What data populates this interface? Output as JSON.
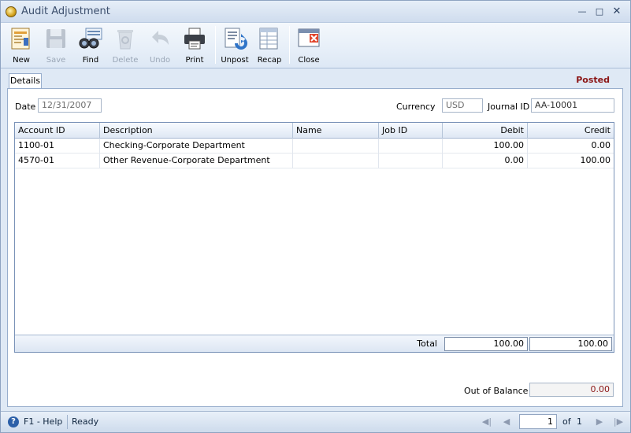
{
  "window": {
    "title": "Audit Adjustment"
  },
  "toolbar": {
    "buttons": [
      {
        "label": "New",
        "icon": "new-document-icon",
        "enabled": true
      },
      {
        "label": "Save",
        "icon": "floppy-disk-icon",
        "enabled": false
      },
      {
        "label": "Find",
        "icon": "binoculars-icon",
        "enabled": true
      },
      {
        "label": "Delete",
        "icon": "recycle-bin-icon",
        "enabled": false
      },
      {
        "label": "Undo",
        "icon": "undo-arrow-icon",
        "enabled": false
      },
      {
        "label": "Print",
        "icon": "printer-icon",
        "enabled": true
      },
      {
        "label": "Unpost",
        "icon": "unpost-icon",
        "enabled": true
      },
      {
        "label": "Recap",
        "icon": "recap-icon",
        "enabled": true
      },
      {
        "label": "Close",
        "icon": "close-window-icon",
        "enabled": true
      }
    ]
  },
  "tabs": [
    {
      "label": "Details",
      "active": true
    }
  ],
  "status": "Posted",
  "form": {
    "date_label": "Date",
    "date_value": "12/31/2007",
    "currency_label": "Currency",
    "currency_value": "USD",
    "journal_label": "Journal ID",
    "journal_value": "AA-10001"
  },
  "grid": {
    "columns": [
      "Account ID",
      "Description",
      "Name",
      "Job ID",
      "Debit",
      "Credit"
    ],
    "rows": [
      {
        "account": "1100-01",
        "description": "Checking-Corporate Department",
        "name": "",
        "job": "",
        "debit": "100.00",
        "credit": "0.00"
      },
      {
        "account": "4570-01",
        "description": "Other Revenue-Corporate Department",
        "name": "",
        "job": "",
        "debit": "0.00",
        "credit": "100.00"
      }
    ],
    "total_label": "Total",
    "total_debit": "100.00",
    "total_credit": "100.00"
  },
  "balance": {
    "label": "Out of Balance",
    "value": "0.00"
  },
  "statusbar": {
    "help": "F1 - Help",
    "state": "Ready",
    "page": "1",
    "of_label": "of",
    "total_pages": "1"
  },
  "colors": {
    "posted": "#8b1515",
    "accent": "#2b5fa8"
  }
}
